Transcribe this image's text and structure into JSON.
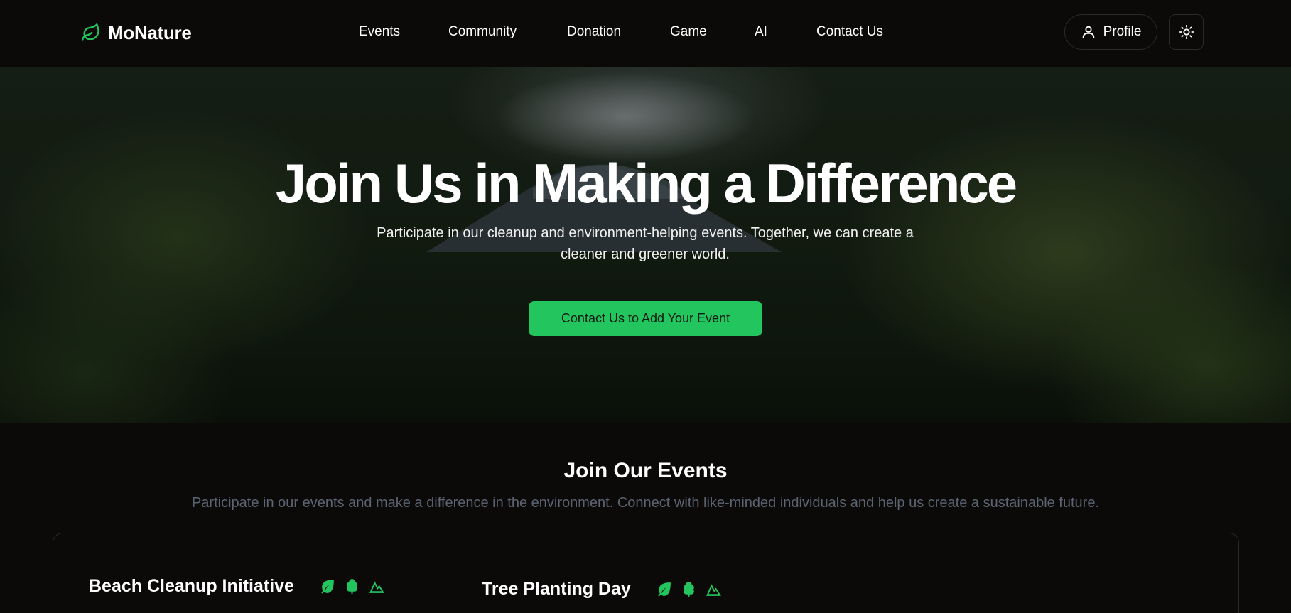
{
  "brand": {
    "name": "MoNature",
    "accent": "#22c55e"
  },
  "nav": {
    "items": [
      "Events",
      "Community",
      "Donation",
      "Game",
      "AI",
      "Contact Us"
    ]
  },
  "header": {
    "profile_label": "Profile"
  },
  "hero": {
    "title": "Join Us in Making a Difference",
    "subtitle": "Participate in our cleanup and environment-helping events. Together, we can create a cleaner and greener world.",
    "cta_label": "Contact Us to Add Your Event"
  },
  "events": {
    "title": "Join Our Events",
    "subtitle": "Participate in our events and make a difference in the environment. Connect with like-minded individuals and help us create a sustainable future.",
    "items": [
      {
        "title": "Beach Cleanup Initiative",
        "icons": [
          "leaf-icon",
          "tree-icon",
          "mountain-icon"
        ]
      },
      {
        "title": "Tree Planting Day",
        "icons": [
          "leaf-icon",
          "tree-icon",
          "mountain-icon"
        ]
      }
    ]
  }
}
